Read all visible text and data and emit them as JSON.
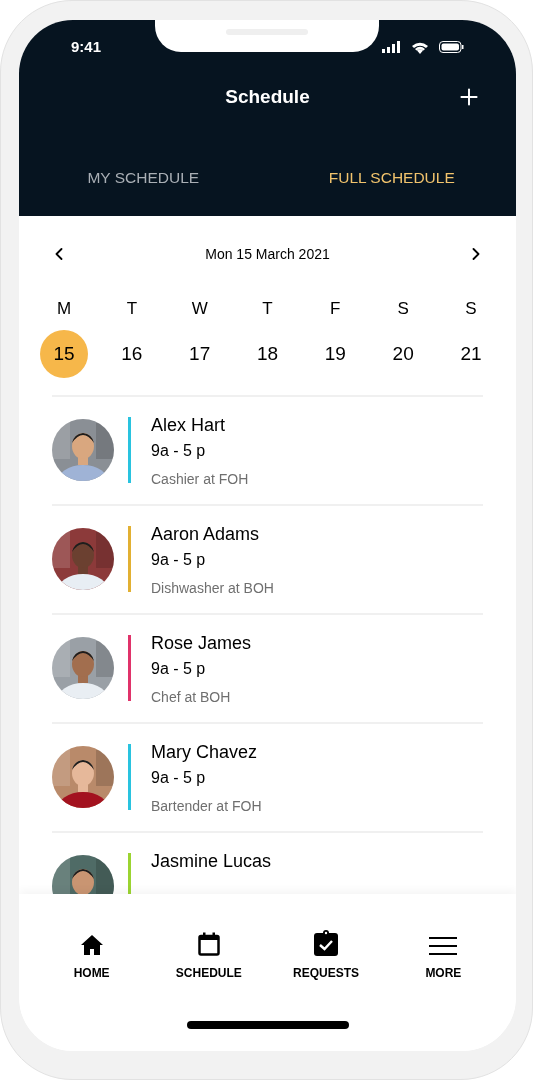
{
  "status_bar": {
    "time": "9:41"
  },
  "header": {
    "title": "Schedule"
  },
  "tabs": [
    {
      "label": "MY SCHEDULE",
      "selected": false
    },
    {
      "label": "FULL SCHEDULE",
      "selected": true
    }
  ],
  "date_nav": {
    "date": "Mon 15 March 2021"
  },
  "week": [
    {
      "weekday": "M",
      "day": "15",
      "selected": true
    },
    {
      "weekday": "T",
      "day": "16",
      "selected": false
    },
    {
      "weekday": "W",
      "day": "17",
      "selected": false
    },
    {
      "weekday": "T",
      "day": "18",
      "selected": false
    },
    {
      "weekday": "F",
      "day": "19",
      "selected": false
    },
    {
      "weekday": "S",
      "day": "20",
      "selected": false
    },
    {
      "weekday": "S",
      "day": "21",
      "selected": false
    }
  ],
  "shifts": [
    {
      "name": "Alex Hart",
      "time": "9a - 5 p",
      "role": "Cashier at FOH",
      "color": "#29c3df"
    },
    {
      "name": "Aaron Adams",
      "time": "9a - 5 p",
      "role": "Dishwasher at BOH",
      "color": "#e2b032"
    },
    {
      "name": "Rose James",
      "time": "9a - 5 p",
      "role": "Chef at BOH",
      "color": "#e0336a"
    },
    {
      "name": "Mary Chavez",
      "time": "9a - 5 p",
      "role": "Bartender at FOH",
      "color": "#29c3df"
    },
    {
      "name": "Jasmine Lucas",
      "color": "#9bd431"
    }
  ],
  "bottom_nav": [
    {
      "label": "HOME"
    },
    {
      "label": "SCHEDULE"
    },
    {
      "label": "REQUESTS"
    },
    {
      "label": "MORE"
    }
  ]
}
